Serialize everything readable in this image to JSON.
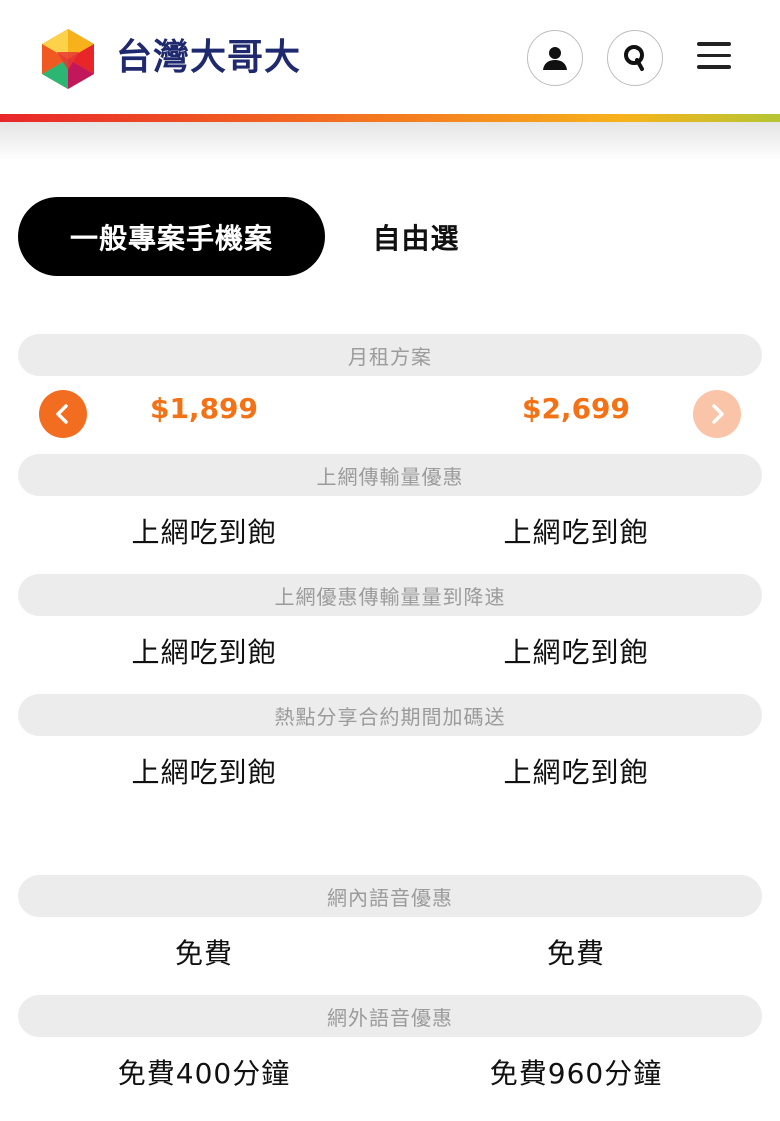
{
  "brand": {
    "name": "台灣大哥大"
  },
  "tabs": [
    {
      "label": "一般專案手機案",
      "active": true
    },
    {
      "label": "自由選",
      "active": false
    }
  ],
  "plans": {
    "left_price": "$1,899",
    "right_price": "$2,699"
  },
  "sections": [
    {
      "title": "月租方案"
    },
    {
      "title": "上網傳輸量優惠",
      "left": "上網吃到飽",
      "right": "上網吃到飽"
    },
    {
      "title": "上網優惠傳輸量量到降速",
      "left": "上網吃到飽",
      "right": "上網吃到飽"
    },
    {
      "title": "熱點分享合約期間加碼送",
      "left": "上網吃到飽",
      "right": "上網吃到飽"
    },
    {
      "title": "網內語音優惠",
      "left": "免費",
      "right": "免費"
    },
    {
      "title": "網外語音優惠",
      "left": "免費400分鐘",
      "right": "免費960分鐘"
    }
  ],
  "colors": {
    "accent": "#f47216",
    "brand_text": "#1f2a6e",
    "pill_bg": "#ececec"
  },
  "icons": {
    "user": "user-icon",
    "search": "search-icon",
    "menu": "hamburger-menu-icon",
    "prev": "chevron-left-icon",
    "next": "chevron-right-icon"
  }
}
